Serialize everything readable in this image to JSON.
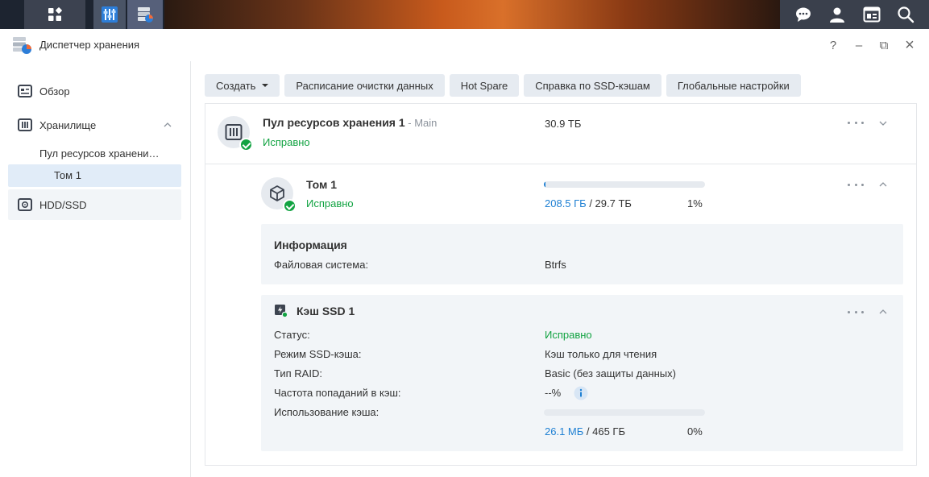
{
  "window": {
    "title": "Диспетчер хранения",
    "help": "?",
    "minimize": "–",
    "restore": "⧉",
    "close": "×"
  },
  "sidebar": {
    "overview": "Обзор",
    "storage": "Хранилище",
    "pool": "Пул ресурсов хранени…",
    "volume": "Том 1",
    "hdd": "HDD/SSD"
  },
  "toolbar": {
    "create": "Создать",
    "scrub": "Расписание очистки данных",
    "hotspare": "Hot Spare",
    "ssd_help": "Справка по SSD-кэшам",
    "global": "Глобальные настройки"
  },
  "pool": {
    "name": "Пул ресурсов хранения 1",
    "sep": " - ",
    "desc": "Main",
    "status": "Исправно",
    "size": "30.9 ТБ"
  },
  "volume": {
    "name": "Том 1",
    "status": "Исправно",
    "used": "208.5 ГБ",
    "total": " / 29.7 ТБ",
    "percent": "1%",
    "fill": 0.01
  },
  "info": {
    "heading": "Информация",
    "fs_label": "Файловая система:",
    "fs_value": "Btrfs"
  },
  "cache": {
    "name": "Кэш SSD 1",
    "status_label": "Статус:",
    "status_value": "Исправно",
    "mode_label": "Режим SSD-кэша:",
    "mode_value": "Кэш только для чтения",
    "raid_label": "Тип RAID:",
    "raid_value": "Basic (без защиты данных)",
    "hit_label": "Частота попаданий в кэш:",
    "hit_value": "--%",
    "usage_label": "Использование кэша:",
    "used": "26.1 МБ",
    "total": " / 465 ГБ",
    "percent": "0%",
    "fill": 0.0
  },
  "colors": {
    "accent": "#1f80d3",
    "ok": "#12a342",
    "button_bg": "#e6ebf1",
    "selected_bg": "#e1ecf8"
  }
}
